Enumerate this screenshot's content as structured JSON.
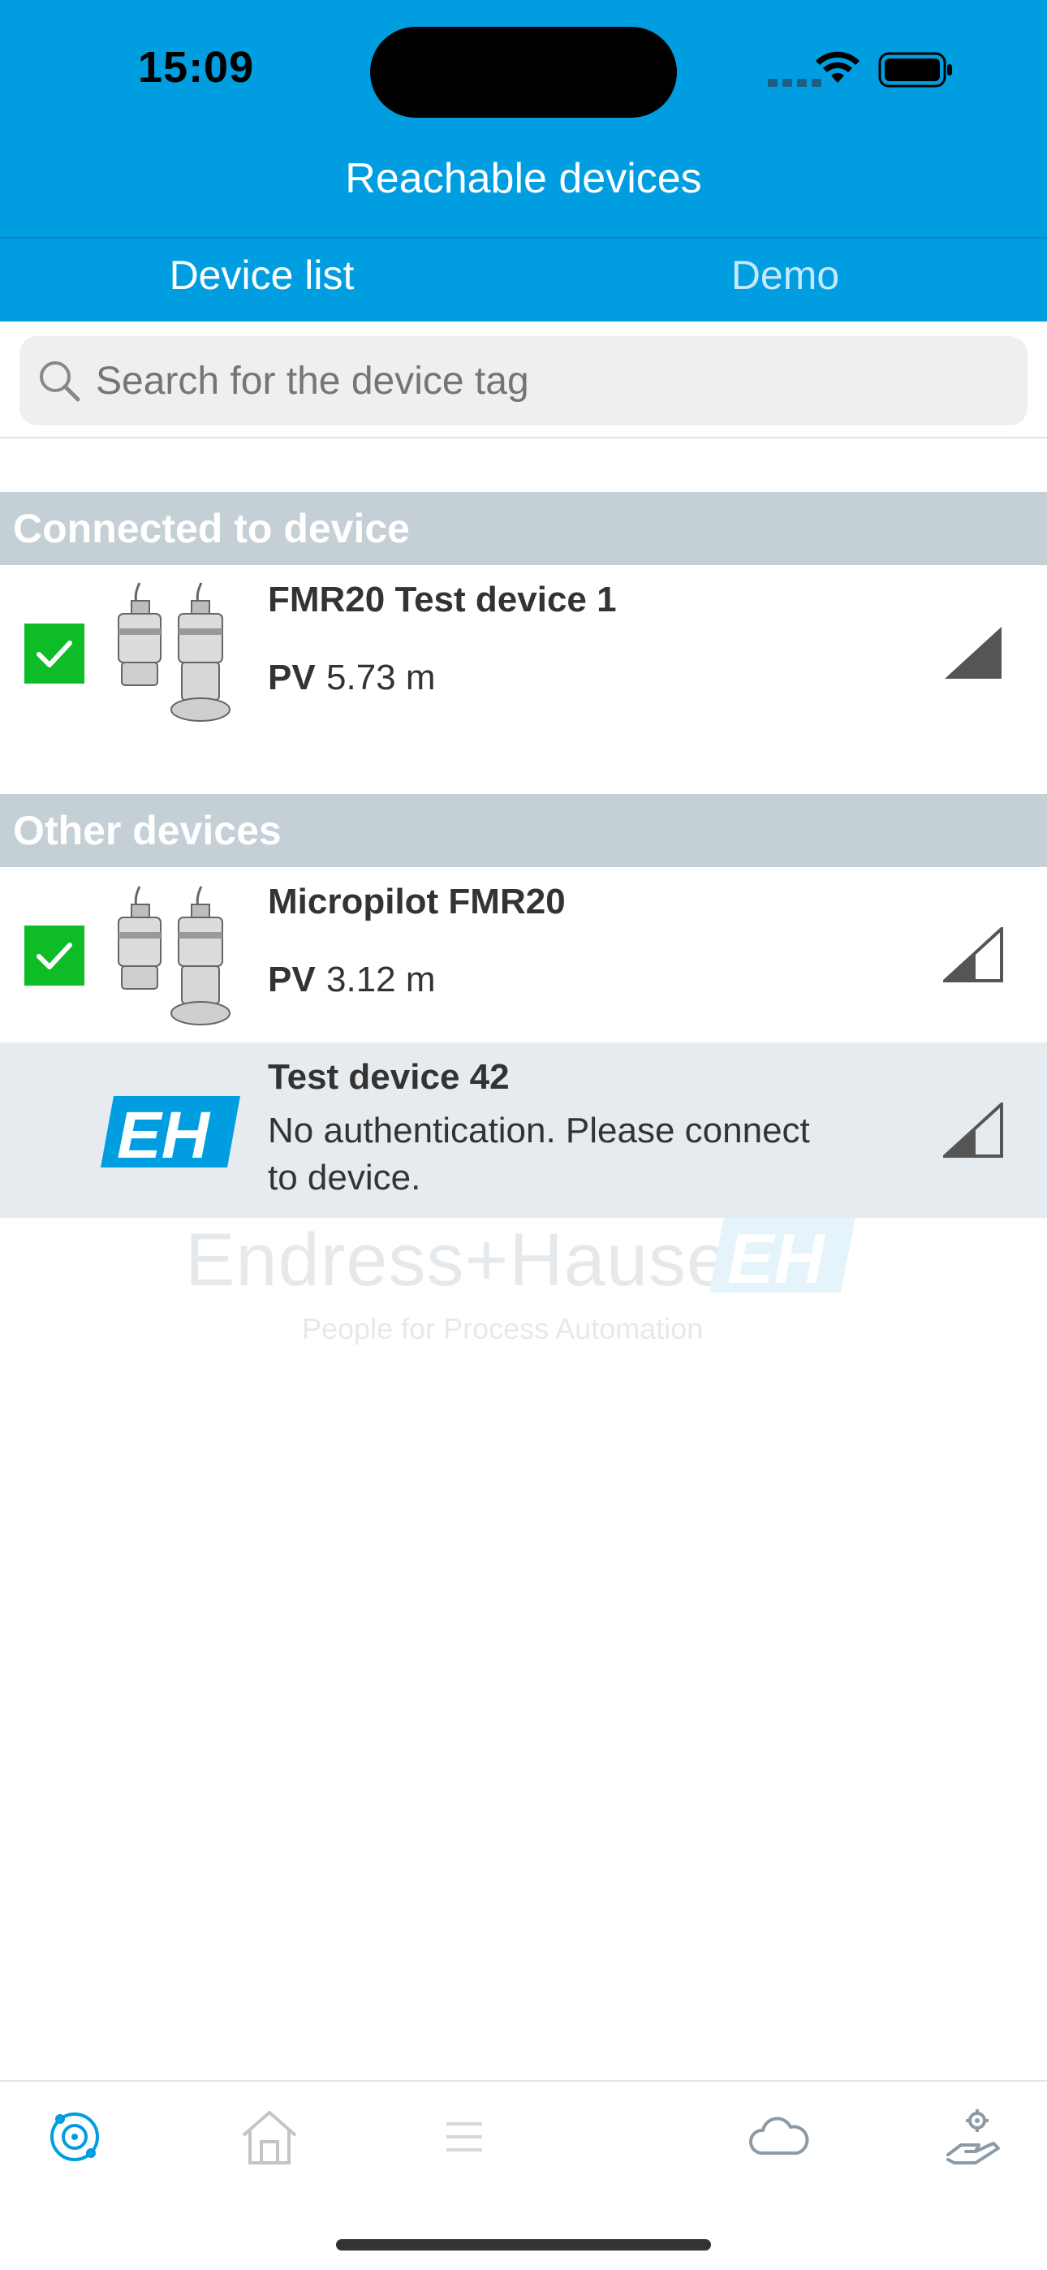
{
  "status_bar": {
    "time": "15:09",
    "icons": [
      "cellular-signal-icon",
      "wifi-icon",
      "battery-icon"
    ]
  },
  "header": {
    "title": "Reachable devices",
    "tabs": [
      {
        "label": "Device list",
        "active": true
      },
      {
        "label": "Demo",
        "active": false
      }
    ]
  },
  "search": {
    "placeholder": "Search for the device tag",
    "value": ""
  },
  "sections": [
    {
      "title": "Connected to device",
      "devices": [
        {
          "name": "FMR20 Test device 1",
          "pv_label": "PV",
          "pv_value": "5.73 m",
          "checked": true,
          "signal_strength": 1.0
        }
      ]
    },
    {
      "title": "Other devices",
      "devices": [
        {
          "name": "Micropilot FMR20",
          "pv_label": "PV",
          "pv_value": "3.12 m",
          "checked": true,
          "signal_strength": 0.33
        },
        {
          "name": "Test device 42",
          "message": "No authentication. Please connect to device.",
          "checked": false,
          "signal_strength": 0.33
        }
      ]
    }
  ],
  "watermark": {
    "brand": "Endress+Hauser",
    "tagline": "People for Process Automation"
  },
  "tab_bar": {
    "items": [
      {
        "icon": "device-scan-icon",
        "active": true
      },
      {
        "icon": "home-icon",
        "active": false
      },
      {
        "icon": "menu-icon",
        "active": false
      },
      {
        "icon": "cloud-icon",
        "active": false
      },
      {
        "icon": "settings-hand-icon",
        "active": false
      }
    ]
  },
  "colors": {
    "brand_blue": "#009ee0",
    "check_green": "#0ebd26",
    "section_gray": "#c5cfd6"
  }
}
